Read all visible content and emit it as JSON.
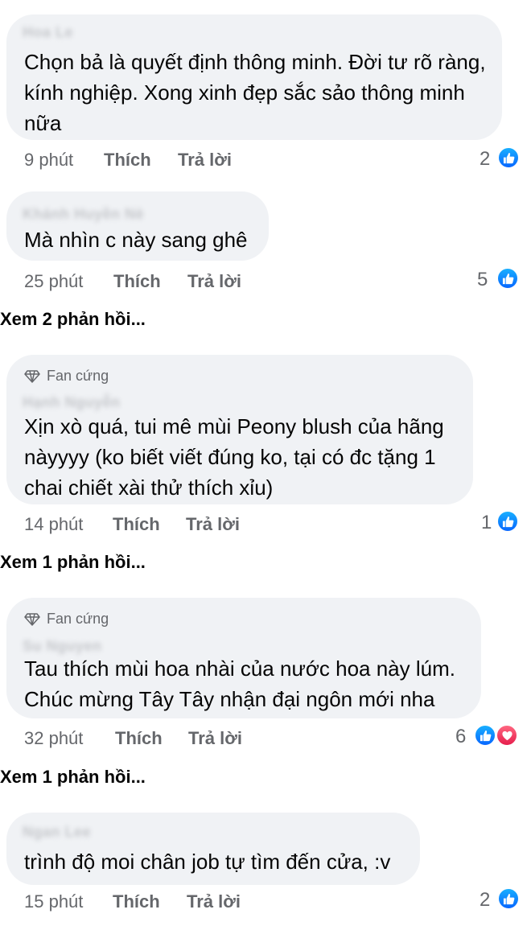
{
  "actions": {
    "like": "Thích",
    "reply": "Trả lời"
  },
  "comments": [
    {
      "author": "Hoa Le",
      "text": "Chọn bả là quyết định thông minh. Đời tư rõ ràng, kính nghiệp. Xong xinh đẹp sắc sảo thông minh nữa",
      "time": "9 phút",
      "reaction_count": "2",
      "reaction_icons": [
        "like-icon"
      ]
    },
    {
      "author": "Khánh Huyền Nè",
      "text": "Mà nhìn c này sang ghê",
      "time": "25 phút",
      "reaction_count": "5",
      "reaction_icons": [
        "like-icon"
      ],
      "replies_link": "Xem 2 phản hồi..."
    },
    {
      "badge": "Fan cứng",
      "author": "Hạnh Nguyễn",
      "text": "Xịn xò quá, tui mê mùi Peony blush của hãng nàyyyy (ko biết viết đúng ko, tại có đc tặng 1 chai chiết xài thử thích xỉu)",
      "time": "14 phút",
      "reaction_count": "1",
      "reaction_icons": [
        "like-icon"
      ],
      "replies_link": "Xem 1 phản hồi..."
    },
    {
      "badge": "Fan cứng",
      "author": "Su Nguyen",
      "text": "Tau thích mùi hoa nhài của nước hoa này lúm. Chúc mừng Tây Tây nhận đại ngôn mới nha",
      "time": "32 phút",
      "reaction_count": "6",
      "reaction_icons": [
        "like-icon",
        "love-icon"
      ],
      "replies_link": "Xem 1 phản hồi..."
    },
    {
      "author": "Ngan Lee",
      "text": "trình độ moi chân job tự tìm đến cửa, :v",
      "time": "15 phút",
      "reaction_count": "2",
      "reaction_icons": [
        "like-icon"
      ]
    }
  ],
  "colors": {
    "bubble": "#f0f2f5",
    "meta": "#65676b",
    "like": "#0866ff",
    "love": "#f33e58"
  }
}
